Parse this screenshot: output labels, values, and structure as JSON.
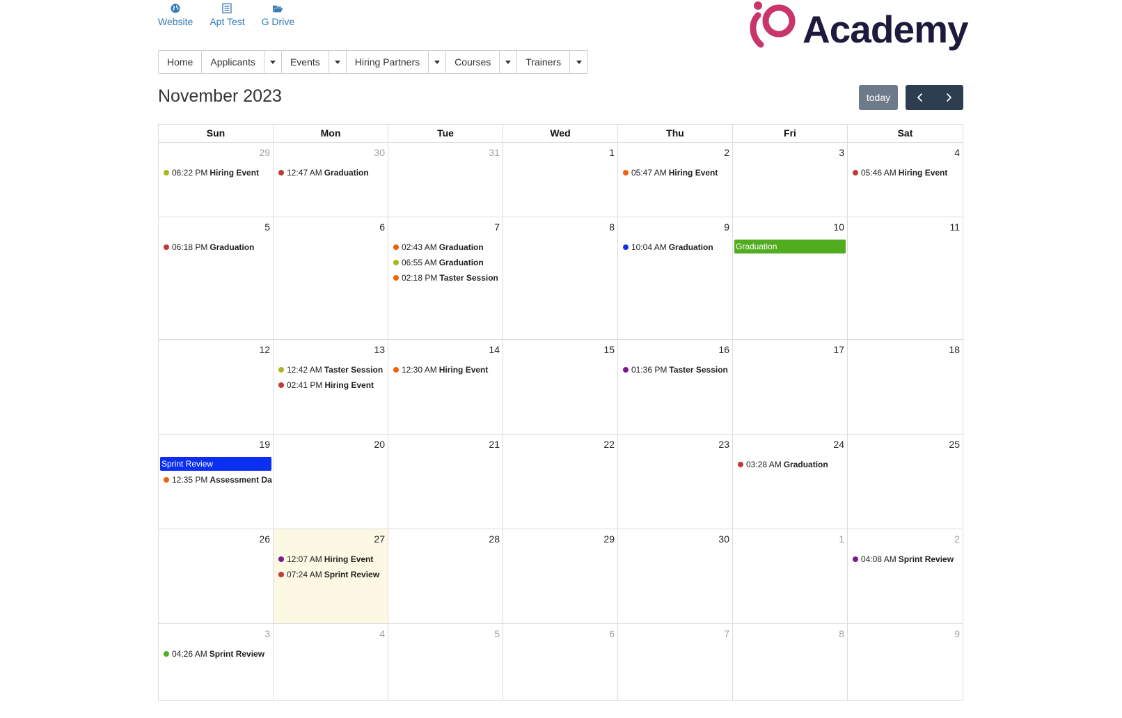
{
  "quick_links": [
    {
      "label": "Website",
      "icon": "globe-icon"
    },
    {
      "label": "Apt Test",
      "icon": "list-icon"
    },
    {
      "label": "G Drive",
      "icon": "folder-open-icon"
    }
  ],
  "logo": {
    "text": "Academy",
    "accent": "#c9346a",
    "text_color": "#1c1a3d"
  },
  "nav": {
    "home": "Home",
    "applicants": "Applicants",
    "events": "Events",
    "hiring_partners": "Hiring Partners",
    "courses": "Courses",
    "trainers": "Trainers"
  },
  "calendar": {
    "title": "November 2023",
    "today_label": "today",
    "prev_icon": "chevron-left-icon",
    "next_icon": "chevron-right-icon",
    "weekdays": [
      "Sun",
      "Mon",
      "Tue",
      "Wed",
      "Thu",
      "Fri",
      "Sat"
    ],
    "weeks": [
      [
        {
          "num": "29",
          "other": true,
          "events": [
            {
              "time": "06:22 PM",
              "title": "Hiring Event",
              "color": "#a9b81f"
            }
          ]
        },
        {
          "num": "30",
          "other": true,
          "events": [
            {
              "time": "12:47 AM",
              "title": "Graduation",
              "color": "#c0393b"
            }
          ]
        },
        {
          "num": "31",
          "other": true,
          "events": []
        },
        {
          "num": "1",
          "events": []
        },
        {
          "num": "2",
          "events": [
            {
              "time": "05:47 AM",
              "title": "Hiring Event",
              "color": "#f0620a"
            }
          ]
        },
        {
          "num": "3",
          "events": []
        },
        {
          "num": "4",
          "events": [
            {
              "time": "05:46 AM",
              "title": "Hiring Event",
              "color": "#c0393b"
            }
          ]
        }
      ],
      [
        {
          "num": "5",
          "events": [
            {
              "time": "06:18 PM",
              "title": "Graduation",
              "color": "#c0393b"
            }
          ]
        },
        {
          "num": "6",
          "events": []
        },
        {
          "num": "7",
          "events": [
            {
              "time": "02:43 AM",
              "title": "Graduation",
              "color": "#f0620a"
            },
            {
              "time": "06:55 AM",
              "title": "Graduation",
              "color": "#a9b81f"
            },
            {
              "time": "02:18 PM",
              "title": "Taster Session",
              "color": "#f0620a"
            }
          ]
        },
        {
          "num": "8",
          "events": []
        },
        {
          "num": "9",
          "events": [
            {
              "time": "10:04 AM",
              "title": "Graduation",
              "color": "#1432e6"
            }
          ]
        },
        {
          "num": "10",
          "events": [
            {
              "block": true,
              "title": "Graduation",
              "color": "#52ac1f"
            }
          ]
        },
        {
          "num": "11",
          "events": []
        }
      ],
      [
        {
          "num": "12",
          "events": []
        },
        {
          "num": "13",
          "events": [
            {
              "time": "12:42 AM",
              "title": "Taster Session",
              "color": "#a9b81f"
            },
            {
              "time": "02:41 PM",
              "title": "Hiring Event",
              "color": "#c0393b"
            }
          ]
        },
        {
          "num": "14",
          "events": [
            {
              "time": "12:30 AM",
              "title": "Hiring Event",
              "color": "#f0620a"
            }
          ]
        },
        {
          "num": "15",
          "events": []
        },
        {
          "num": "16",
          "events": [
            {
              "time": "01:36 PM",
              "title": "Taster Session",
              "color": "#7a1a8c"
            }
          ]
        },
        {
          "num": "17",
          "events": []
        },
        {
          "num": "18",
          "events": []
        }
      ],
      [
        {
          "num": "19",
          "events": [
            {
              "block": true,
              "title": "Sprint Review",
              "color": "#0a2ff0"
            },
            {
              "time": "12:35 PM",
              "title": "Assessment Da",
              "color": "#f0620a"
            }
          ]
        },
        {
          "num": "20",
          "events": []
        },
        {
          "num": "21",
          "events": []
        },
        {
          "num": "22",
          "events": []
        },
        {
          "num": "23",
          "events": []
        },
        {
          "num": "24",
          "events": [
            {
              "time": "03:28 AM",
              "title": "Graduation",
              "color": "#c0393b"
            }
          ]
        },
        {
          "num": "25",
          "events": []
        }
      ],
      [
        {
          "num": "26",
          "events": []
        },
        {
          "num": "27",
          "today": true,
          "events": [
            {
              "time": "12:07 AM",
              "title": "Hiring Event",
              "color": "#7a1a8c"
            },
            {
              "time": "07:24 AM",
              "title": "Sprint Review",
              "color": "#c0393b"
            }
          ]
        },
        {
          "num": "28",
          "events": []
        },
        {
          "num": "29",
          "events": []
        },
        {
          "num": "30",
          "events": []
        },
        {
          "num": "1",
          "other": true,
          "events": []
        },
        {
          "num": "2",
          "other": true,
          "events": [
            {
              "time": "04:08 AM",
              "title": "Sprint Review",
              "color": "#7a1a8c"
            }
          ]
        }
      ],
      [
        {
          "num": "3",
          "other": true,
          "events": [
            {
              "time": "04:26 AM",
              "title": "Sprint Review",
              "color": "#52ac1f"
            }
          ]
        },
        {
          "num": "4",
          "other": true,
          "events": []
        },
        {
          "num": "5",
          "other": true,
          "events": []
        },
        {
          "num": "6",
          "other": true,
          "events": []
        },
        {
          "num": "7",
          "other": true,
          "events": []
        },
        {
          "num": "8",
          "other": true,
          "events": []
        },
        {
          "num": "9",
          "other": true,
          "events": []
        }
      ]
    ]
  }
}
